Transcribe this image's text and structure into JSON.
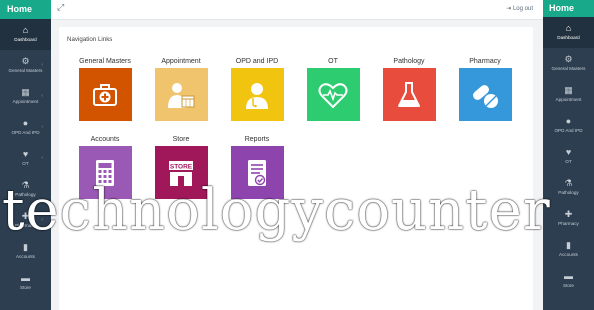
{
  "sidebar": {
    "brand": "Home",
    "items": [
      {
        "label": "Dashboard",
        "icon": "home-icon",
        "glyph": "⌂",
        "active": true
      },
      {
        "label": "General Masters",
        "icon": "gear-icon",
        "glyph": "⚙"
      },
      {
        "label": "Appointment",
        "icon": "calendar-icon",
        "glyph": "▦"
      },
      {
        "label": "OPD And IPD",
        "icon": "user-icon",
        "glyph": "👤"
      },
      {
        "label": "OT",
        "icon": "heart-icon",
        "glyph": "♥"
      },
      {
        "label": "Pathology",
        "icon": "flask-icon",
        "glyph": "⚗"
      },
      {
        "label": "Pharmacy",
        "icon": "pill-icon",
        "glyph": "✚"
      },
      {
        "label": "Accounts",
        "icon": "bar-chart-icon",
        "glyph": "▮"
      },
      {
        "label": "Store",
        "icon": "briefcase-icon",
        "glyph": "▬"
      }
    ]
  },
  "right_sidebar": {
    "brand": "Home",
    "items": [
      "Dashboard",
      "General Masters",
      "Appointment",
      "OPD And IPD",
      "OT",
      "Pathology",
      "Pharmacy",
      "Accounts",
      "Store"
    ]
  },
  "topbar": {
    "logout": "Log out",
    "expand_icon": "expand-icon",
    "logout_icon": "logout-icon"
  },
  "panel": {
    "title": "Navigation Links",
    "tiles": [
      {
        "label": "General Masters",
        "color": "#d35400",
        "icon": "first-aid-kit-icon"
      },
      {
        "label": "Appointment",
        "color": "#f0c36d",
        "icon": "doctor-calendar-icon"
      },
      {
        "label": "OPD and IPD",
        "color": "#f1c40f",
        "icon": "doctor-icon"
      },
      {
        "label": "OT",
        "color": "#2ecc71",
        "icon": "heartbeat-icon"
      },
      {
        "label": "Pathology",
        "color": "#e74c3c",
        "icon": "flask-icon"
      },
      {
        "label": "Pharmacy",
        "color": "#3498db",
        "icon": "pills-icon"
      },
      {
        "label": "Accounts",
        "color": "#9b59b6",
        "icon": "calculator-icon"
      },
      {
        "label": "Store",
        "color": "#a0185a",
        "icon": "store-icon",
        "sign": "STORE"
      },
      {
        "label": "Reports",
        "color": "#8e44ad",
        "icon": "report-icon"
      }
    ]
  },
  "watermark": "technologycounter"
}
